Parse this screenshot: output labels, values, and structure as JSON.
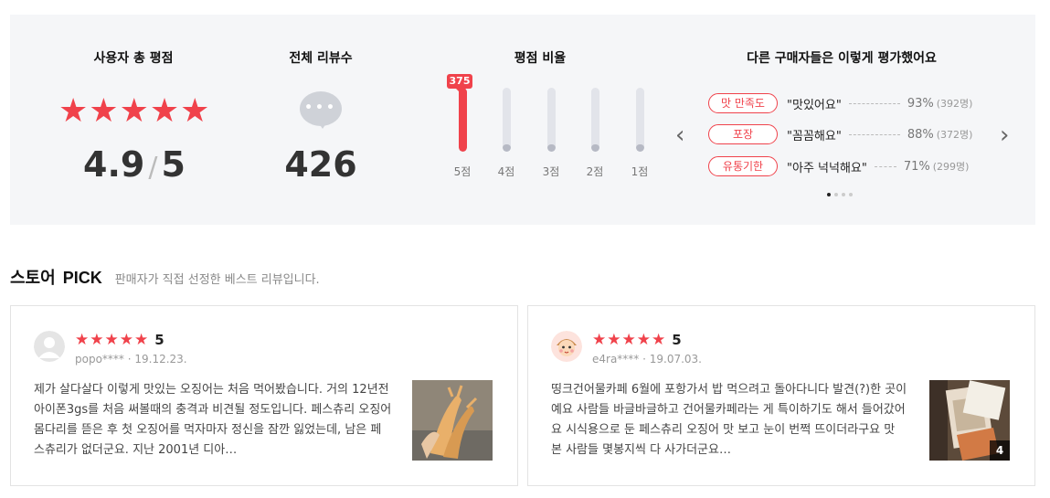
{
  "summary": {
    "avg_title": "사용자 총 평점",
    "avg_value": "4.9",
    "avg_max": "5",
    "avg_stars": 5,
    "total_title": "전체 리뷰수",
    "total_value": "426",
    "ratio_title": "평점 비율",
    "bars": [
      {
        "label": "5점",
        "count": "375",
        "fill_pct": 100,
        "highlight": true
      },
      {
        "label": "4점",
        "fill_pct": 12,
        "highlight": false
      },
      {
        "label": "3점",
        "fill_pct": 12,
        "highlight": false
      },
      {
        "label": "2점",
        "fill_pct": 12,
        "highlight": false
      },
      {
        "label": "1점",
        "fill_pct": 12,
        "highlight": false
      }
    ],
    "eval_title": "다른 구매자들은 이렇게 평가했어요",
    "eval_items": [
      {
        "tag": "맛 만족도",
        "quote": "\"맛있어요\"",
        "pct": "93%",
        "count": "(392명)"
      },
      {
        "tag": "포장",
        "quote": "\"꼼꼼해요\"",
        "pct": "88%",
        "count": "(372명)"
      },
      {
        "tag": "유통기한",
        "quote": "\"아주 넉넉해요\"",
        "pct": "71%",
        "count": "(299명)"
      }
    ],
    "pager_active": 0,
    "pager_total": 4
  },
  "pick": {
    "title": "스토어",
    "title2": "PICK",
    "desc": "판매자가 직접 선정한 베스트 리뷰입니다."
  },
  "reviews": [
    {
      "score": "5",
      "meta": "popo**** · 19.12.23.",
      "text": "제가 살다살다 이렇게 맛있는 오징어는 처음 먹어봤습니다. 거의 12년전 아이폰3gs를 처음 써볼때의 충격과 비견될 정도입니다. 페스츄리 오징어 몸다리를 뜯은 후 첫 오징어를 먹자마자 정신을 잠깐 잃었는데, 남은 페스츄리가 없더군요. 지난 2001년 디아…",
      "image_count": ""
    },
    {
      "score": "5",
      "meta": "e4ra**** · 19.07.03.",
      "text": "띵크건어물카페 6월에 포항가서 밥 먹으려고 돌아다니다 발견(?)한 곳이예요 사람들 바글바글하고 건어물카페라는 게 특이하기도 해서 들어갔어요 시식용으로 둔 페스츄리 오징어 맛 보고 눈이 번쩍 뜨이더라구요 맛 본 사람들 몇봉지씩 다 사가더군요…",
      "image_count": "4"
    }
  ],
  "colors": {
    "accent": "#f0424b",
    "panel_bg": "#f5f6f8"
  }
}
